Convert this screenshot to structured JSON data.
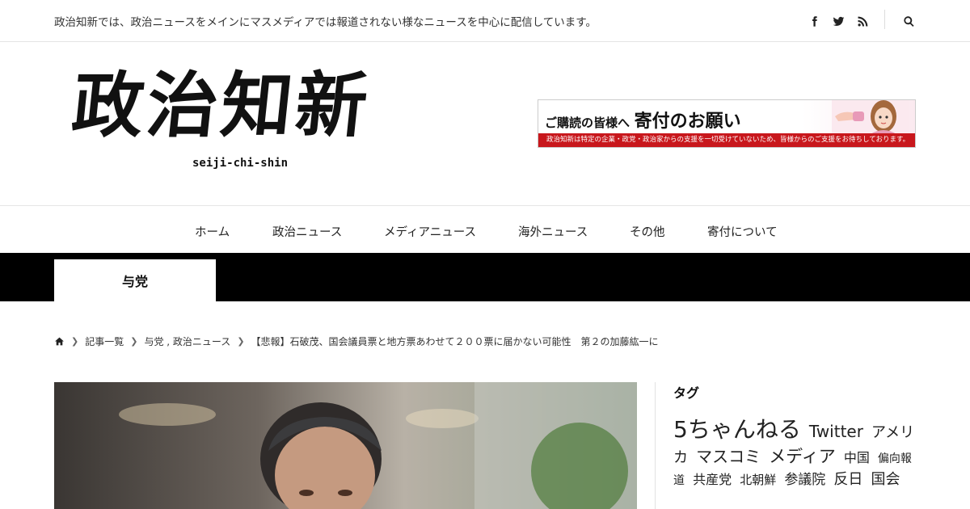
{
  "topbar": {
    "tagline": "政治知新では、政治ニュースをメインにマスメディアでは報道されない様なニュースを中心に配信しています。",
    "social_icons": [
      "facebook-icon",
      "twitter-icon",
      "rss-icon"
    ],
    "search_icon": "search-icon"
  },
  "header": {
    "logo_text": "政治知新",
    "logo_subtext": "seiji-chi-shin",
    "banner": {
      "lead": "ご購読の皆様へ",
      "headline": "寄付のお願い",
      "strip": "政治知新は特定の企業・政党・政治家からの支援を一切受けていないため、皆様からのご支援をお待ちしております。"
    }
  },
  "nav": {
    "items": [
      "ホーム",
      "政治ニュース",
      "メディアニュース",
      "海外ニュース",
      "その他",
      "寄付について"
    ]
  },
  "category": {
    "tab_label": "与党"
  },
  "breadcrumb": {
    "home_icon": "home-icon",
    "items": [
      "記事一覧",
      "与党 , 政治ニュース",
      "【悲報】石破茂、国会議員票と地方票あわせて２００票に届かない可能性　第２の加藤紘一に"
    ]
  },
  "sidebar": {
    "heading": "タグ",
    "tags": [
      {
        "label": "5ちゃんねる",
        "size": 28
      },
      {
        "label": "Twitter",
        "size": 20
      },
      {
        "label": "アメリカ",
        "size": 18
      },
      {
        "label": "マスコミ",
        "size": 20
      },
      {
        "label": "メディア",
        "size": 21
      },
      {
        "label": "中国",
        "size": 16
      },
      {
        "label": "偏向報道",
        "size": 14
      },
      {
        "label": "共産党",
        "size": 16
      },
      {
        "label": "北朝鮮",
        "size": 15
      },
      {
        "label": "参議院",
        "size": 17
      },
      {
        "label": "反日",
        "size": 18
      },
      {
        "label": "国会",
        "size": 18
      }
    ]
  },
  "colors": {
    "band": "#000000",
    "banner_strip": "#c8171c",
    "text": "#222222"
  }
}
